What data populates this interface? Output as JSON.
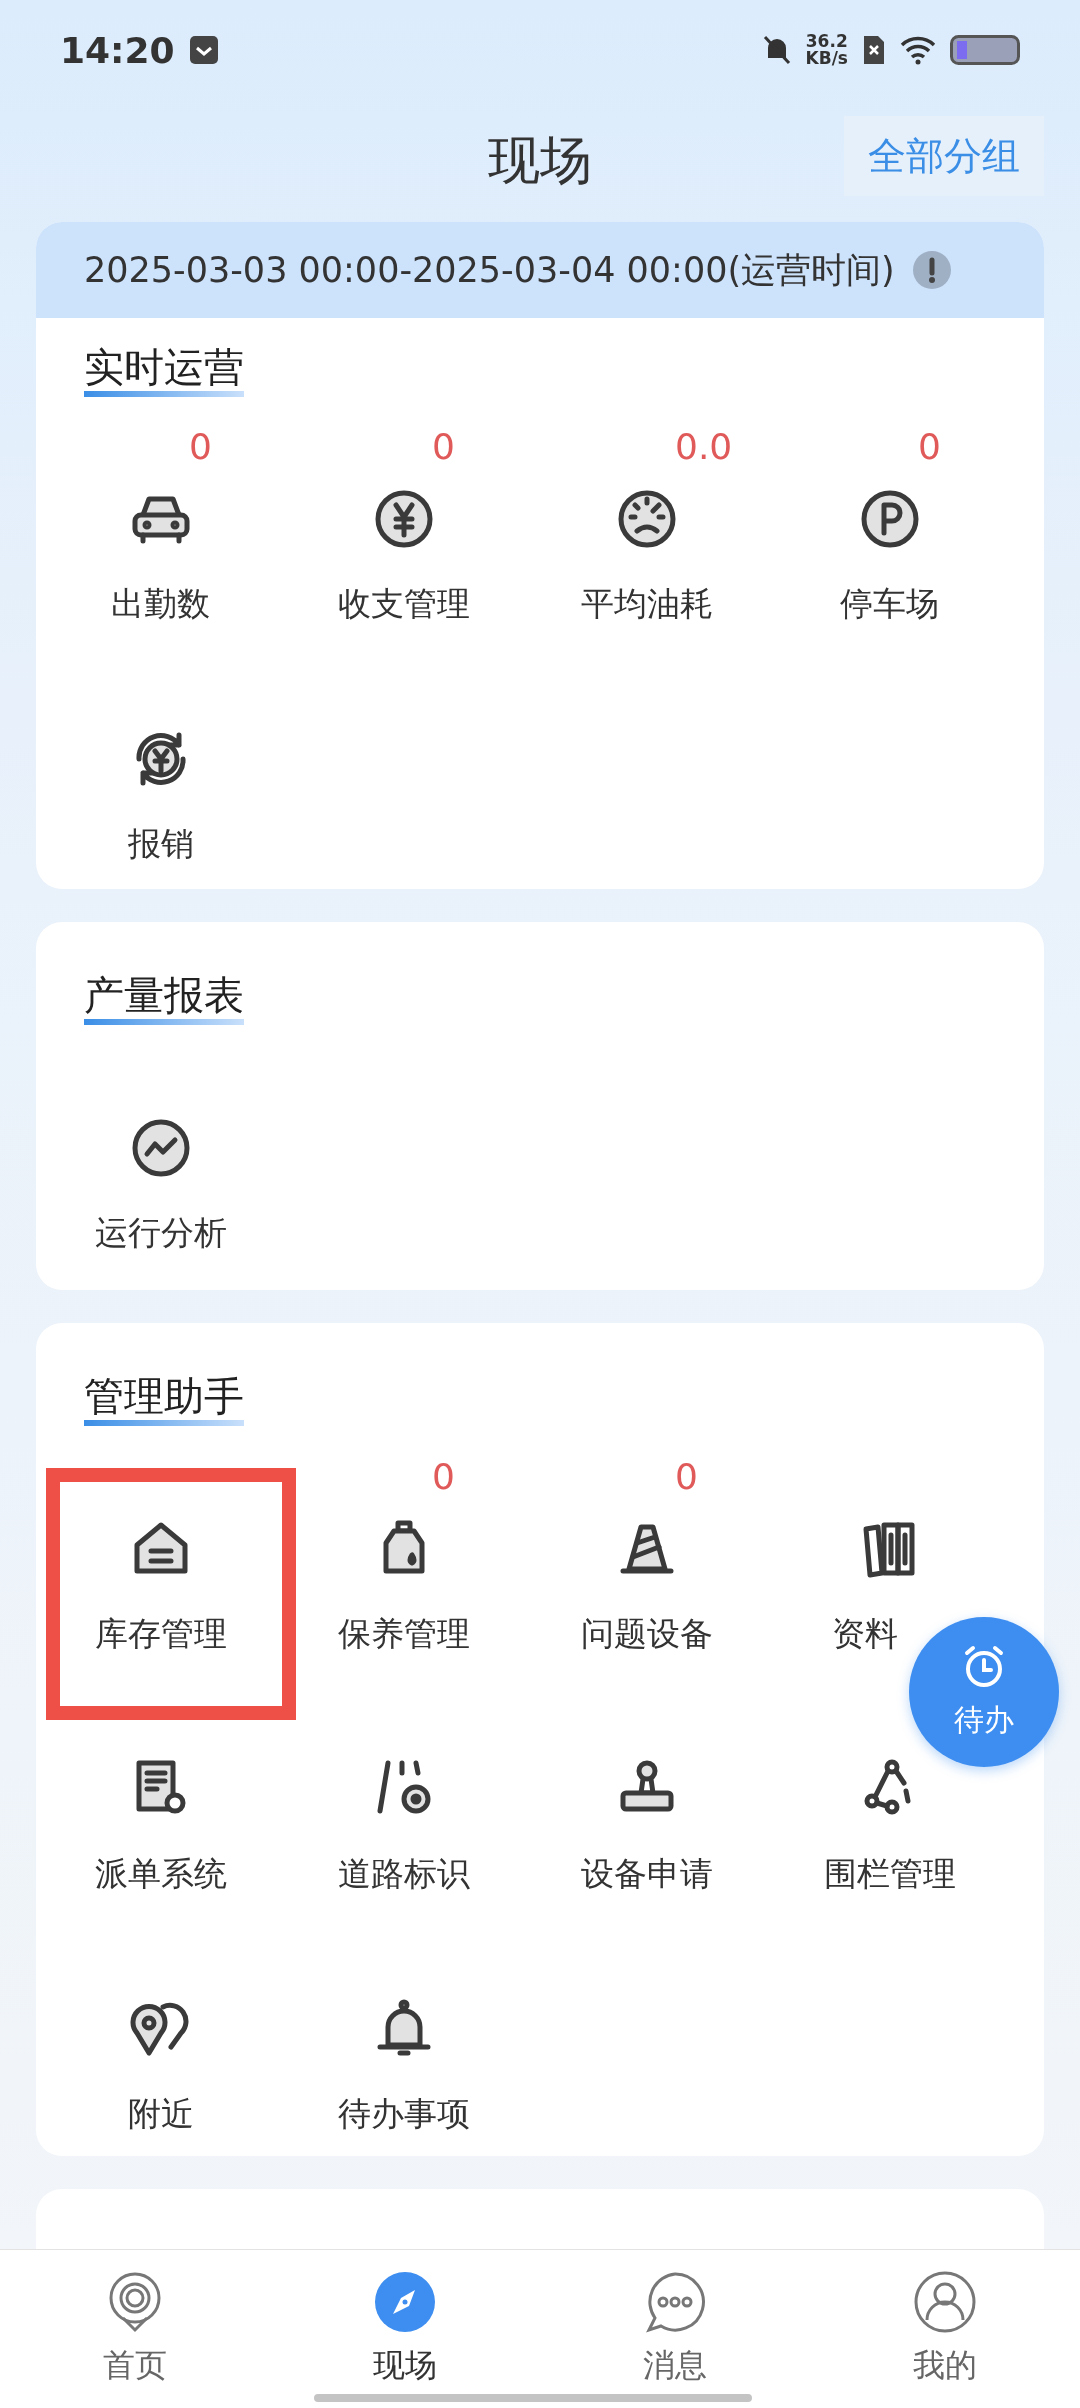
{
  "status_bar": {
    "time": "14:20",
    "speed_value": "36.2",
    "speed_unit": "KB/s"
  },
  "header": {
    "title": "现场",
    "group_button": "全部分组"
  },
  "banner": {
    "text": "2025-03-03 00:00-2025-03-04 00:00(运营时间)"
  },
  "sections": [
    {
      "title": "实时运营",
      "items": [
        {
          "label": "出勤数",
          "count": "0"
        },
        {
          "label": "收支管理",
          "count": "0"
        },
        {
          "label": "平均油耗",
          "count": "0.0"
        },
        {
          "label": "停车场",
          "count": "0"
        },
        {
          "label": "报销"
        }
      ]
    },
    {
      "title": "产量报表",
      "items": [
        {
          "label": "运行分析"
        }
      ]
    },
    {
      "title": "管理助手",
      "items": [
        {
          "label": "库存管理",
          "highlighted": true
        },
        {
          "label": "保养管理",
          "count": "0"
        },
        {
          "label": "问题设备",
          "count": "0"
        },
        {
          "label": "资料",
          "covered_by_float": true
        },
        {
          "label": "派单系统"
        },
        {
          "label": "道路标识"
        },
        {
          "label": "设备申请"
        },
        {
          "label": "围栏管理"
        },
        {
          "label": "附近"
        },
        {
          "label": "待办事项"
        }
      ]
    }
  ],
  "floating_button": {
    "label": "待办"
  },
  "tab_bar": [
    {
      "label": "首页",
      "selected": false
    },
    {
      "label": "现场",
      "selected": true
    },
    {
      "label": "消息",
      "selected": false
    },
    {
      "label": "我的",
      "selected": false
    }
  ]
}
